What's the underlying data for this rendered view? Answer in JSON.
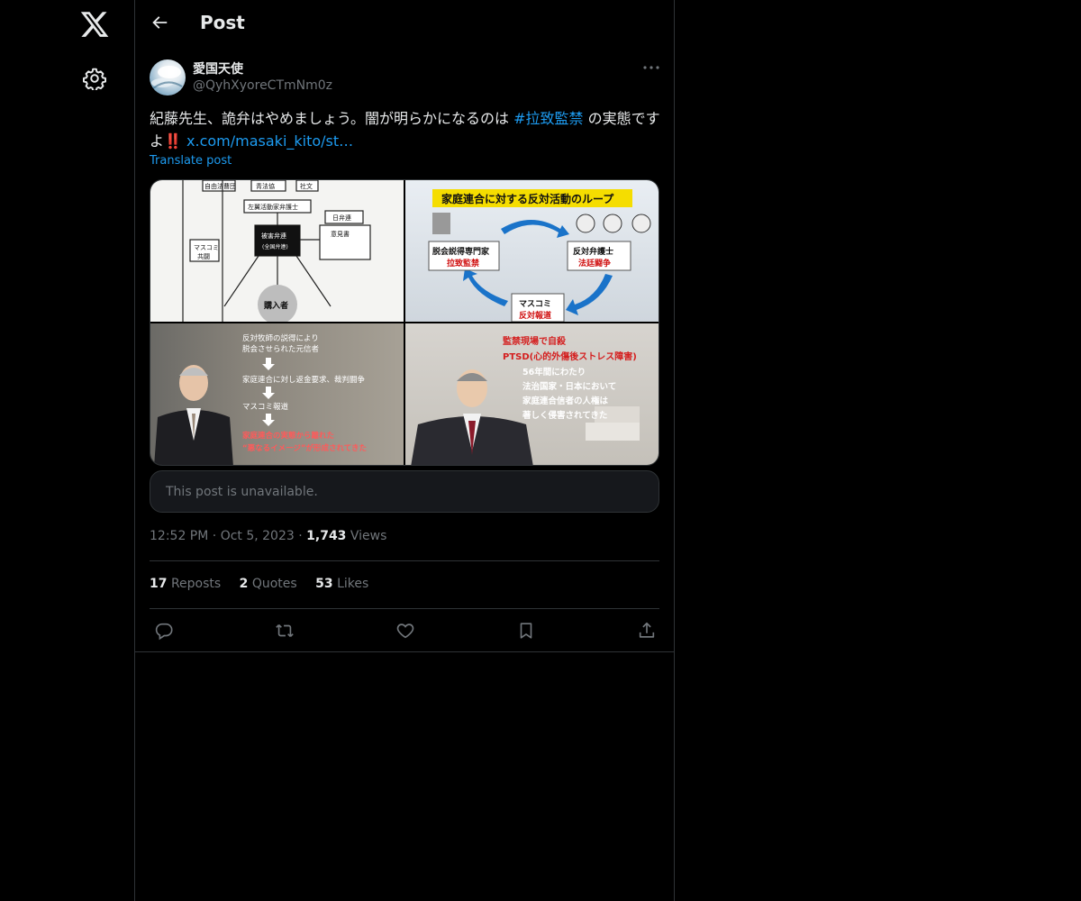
{
  "nav": {
    "logo_icon": "x-logo-icon",
    "settings_icon": "gear-icon"
  },
  "header": {
    "title": "Post",
    "back_icon": "arrow-left-icon"
  },
  "author": {
    "display_name": "愛国天使",
    "handle": "@QyhXyoreCTmNm0z"
  },
  "tweet": {
    "text_prefix": "紀藤先生、詭弁はやめましょう。闇が明らかになるのは ",
    "hashtag": "#拉致監禁",
    "text_suffix": " の実態ですよ",
    "emoji": "‼️",
    "link": "x.com/masaki_kito/st…",
    "translate_label": "Translate post"
  },
  "media": {
    "image1": {
      "labels": [
        "自由法曹団",
        "青法協",
        "社文",
        "左翼活動家弁護士",
        "日弁連",
        "被害弁連",
        "(全国弁連)",
        "意見書",
        "マスコミ",
        "共闘",
        "購入者"
      ]
    },
    "image2": {
      "title": "家庭連合に対する反対活動のループ",
      "box1": "脱会説得専門家",
      "box1_sub": "拉致監禁",
      "box2": "反対弁護士",
      "box2_sub": "法廷闘争",
      "box3": "マスコミ",
      "box3_sub": "反対報道"
    },
    "image3": {
      "lines": [
        "反対牧師の説得により",
        "脱会させられた元信者",
        "家庭連合に対し返金要求、裁判闘争",
        "マスコミ報道"
      ],
      "red_lines": [
        "家庭連合の実態から離れた",
        "“悪なるイメージ”が形成されてきた"
      ]
    },
    "image4": {
      "red_lines": [
        "監禁現場で自殺",
        "PTSD(心的外傷後ストレス障害)"
      ],
      "lines": [
        "56年間にわたり",
        "法治国家・日本において",
        "家庭連合信者の人権は",
        "著しく侵害されてきた"
      ]
    }
  },
  "quote": {
    "unavailable_text": "This post is unavailable."
  },
  "meta": {
    "time": "12:52 PM",
    "date": "Oct 5, 2023",
    "views_count": "1,743",
    "views_label": "Views"
  },
  "stats": {
    "reposts_count": "17",
    "reposts_label": "Reposts",
    "quotes_count": "2",
    "quotes_label": "Quotes",
    "likes_count": "53",
    "likes_label": "Likes"
  },
  "actions": [
    "reply-icon",
    "repost-icon",
    "like-icon",
    "bookmark-icon",
    "share-icon"
  ]
}
